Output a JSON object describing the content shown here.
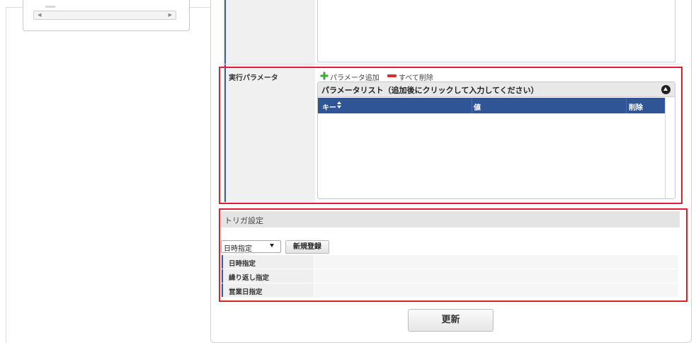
{
  "parameter_section": {
    "label": "実行パラメータ",
    "add_link": "パラメータ追加",
    "delete_all_link": "すべて削除",
    "grid_caption": "パラメータリスト（追加後にクリックして入力してください）",
    "columns": {
      "key": "キー",
      "value": "値",
      "delete": "削除"
    },
    "rows": []
  },
  "trigger_section": {
    "title": "トリガ設定",
    "type_select": {
      "selected": "日時指定"
    },
    "new_button_label": "新規登録",
    "rows": [
      {
        "label": "日時指定",
        "value": ""
      },
      {
        "label": "繰り返し指定",
        "value": ""
      },
      {
        "label": "営業日指定",
        "value": ""
      }
    ]
  },
  "update_button_label": "更新",
  "colors": {
    "highlight": "#e0202a",
    "grid_header": "#2f5597",
    "accent_bar": "#3b5998",
    "add_icon": "#3cab36",
    "remove_icon": "#dd2a2a"
  },
  "icons": {
    "add": "plus-icon",
    "remove": "minus-icon",
    "sort": "sort-icon",
    "collapse": "collapse-up-icon",
    "dropdown": "caret-down-icon"
  }
}
